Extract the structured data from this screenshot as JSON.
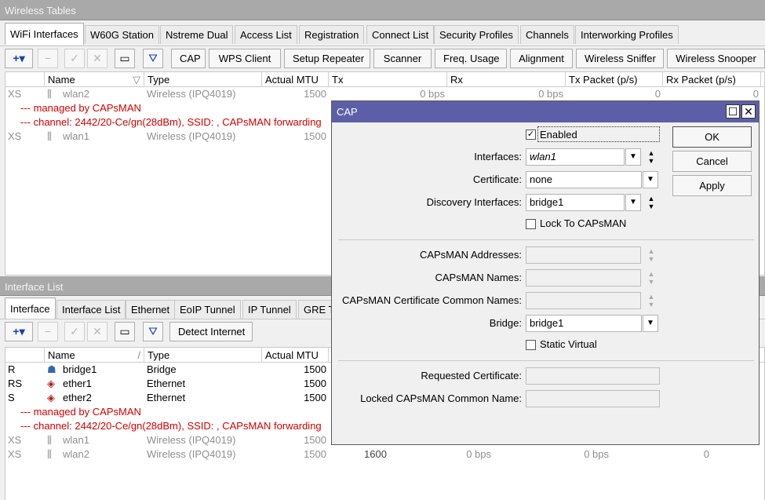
{
  "wireless": {
    "title": "Wireless Tables",
    "tabs": [
      "WiFi Interfaces",
      "W60G Station",
      "Nstreme Dual",
      "Access List",
      "Registration",
      "Connect List",
      "Security Profiles",
      "Channels",
      "Interworking Profiles"
    ],
    "toolbar": [
      "CAP",
      "WPS Client",
      "Setup Repeater",
      "Scanner",
      "Freq. Usage",
      "Alignment",
      "Wireless Sniffer",
      "Wireless Snooper"
    ],
    "columns": [
      "",
      "Name",
      "Type",
      "Actual MTU",
      "Tx",
      "Rx",
      "Tx Packet (p/s)",
      "Rx Packet (p/s)",
      "R"
    ],
    "rows": [
      {
        "flag": "XS",
        "name": "wlan2",
        "type": "Wireless (IPQ4019)",
        "mtu": "1500",
        "tx": "0 bps",
        "rx": "0 bps",
        "txp": "0",
        "rxp": "0"
      },
      {
        "note": "--- managed by CAPsMAN"
      },
      {
        "note": "--- channel: 2442/20-Ce/gn(28dBm), SSID: , CAPsMAN forwarding"
      },
      {
        "flag": "XS",
        "name": "wlan1",
        "type": "Wireless (IPQ4019)",
        "mtu": "1500"
      }
    ]
  },
  "iface": {
    "title": "Interface List",
    "tabs": [
      "Interface",
      "Interface List",
      "Ethernet",
      "EoIP Tunnel",
      "IP Tunnel",
      "GRE T"
    ],
    "toolbar": [
      "Detect Internet"
    ],
    "columns": [
      "",
      "Name",
      "Type",
      "Actual MTU"
    ],
    "rows": [
      {
        "flag": "R",
        "name": "bridge1",
        "type": "Bridge",
        "mtu": "1500"
      },
      {
        "flag": "RS",
        "name": "ether1",
        "type": "Ethernet",
        "mtu": "1500"
      },
      {
        "flag": "S",
        "name": "ether2",
        "type": "Ethernet",
        "mtu": "1500"
      },
      {
        "note": "--- managed by CAPsMAN"
      },
      {
        "note": "--- channel: 2442/20-Ce/gn(28dBm), SSID: , CAPsMAN forwarding"
      },
      {
        "flag": "XS",
        "name": "wlan1",
        "type": "Wireless (IPQ4019)",
        "mtu": "1500"
      },
      {
        "flag": "XS",
        "name": "wlan2",
        "type": "Wireless (IPQ4019)",
        "mtu": "1500",
        "l2mtu": "1600",
        "tx": "0 bps",
        "rx": "0 bps",
        "txp": "0"
      }
    ]
  },
  "cap": {
    "title": "CAP",
    "enabled_label": "Enabled",
    "interfaces_label": "Interfaces:",
    "interfaces_value": "wlan1",
    "certificate_label": "Certificate:",
    "certificate_value": "none",
    "discovery_label": "Discovery Interfaces:",
    "discovery_value": "bridge1",
    "lock_label": "Lock To CAPsMAN",
    "addresses_label": "CAPsMAN Addresses:",
    "names_label": "CAPsMAN Names:",
    "cert_names_label": "CAPsMAN Certificate Common Names:",
    "bridge_label": "Bridge:",
    "bridge_value": "bridge1",
    "static_label": "Static Virtual",
    "req_cert_label": "Requested Certificate:",
    "locked_label": "Locked CAPsMAN Common Name:",
    "ok": "OK",
    "cancel": "Cancel",
    "apply": "Apply"
  },
  "colors": {
    "accent": "#5c5fa8",
    "error": "#d40000",
    "disabled": "#8f8f8f"
  }
}
